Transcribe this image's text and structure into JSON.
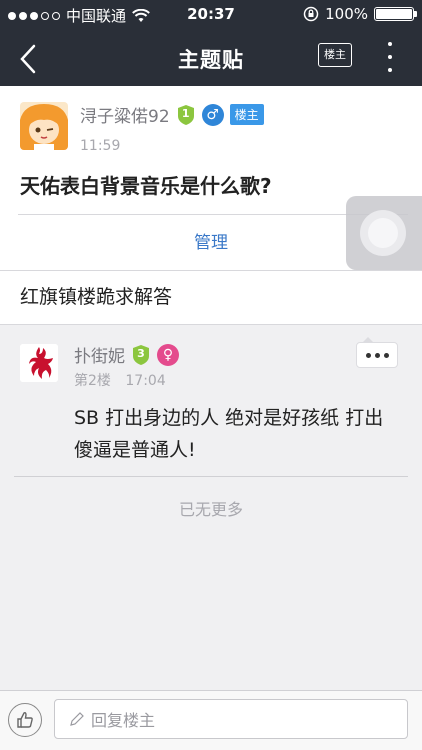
{
  "status_bar": {
    "carrier": "中国联通",
    "time": "20:37",
    "battery": "100%"
  },
  "nav": {
    "title": "主题贴",
    "owner_only_label": "楼主"
  },
  "post": {
    "author": "浔子粱偌92",
    "level": "1",
    "owner_tag": "楼主",
    "time": "11:59",
    "title": "天佑表白背景音乐是什么歌?",
    "manage_label": "管理",
    "body": "红旗镇楼跪求解答"
  },
  "reply": {
    "author": "扑街妮",
    "level": "3",
    "floor": "第2楼",
    "time": "17:04",
    "content": "SB 打出身边的人 绝对是好孩纸 打出傻逼是普通人!"
  },
  "footer_text": "已无更多",
  "bottom_bar": {
    "reply_placeholder": "回复楼主"
  },
  "colors": {
    "nav_bg": "#2a2f38",
    "owner_tag": "#3a98e8",
    "manage_link": "#3a78c8",
    "male": "#2f86d8",
    "female": "#e44b8d",
    "level_badge": "#8cc63f"
  }
}
